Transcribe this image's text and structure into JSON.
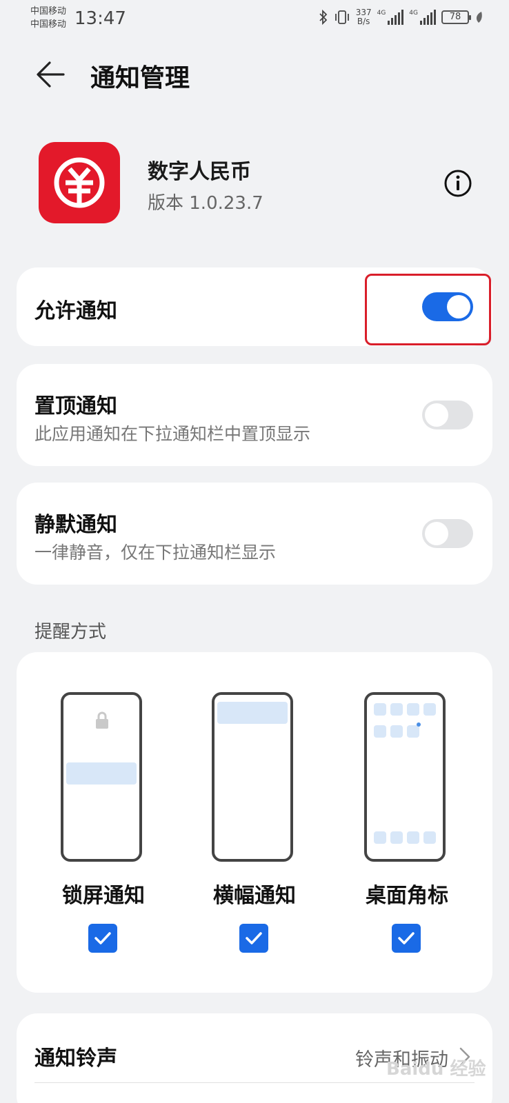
{
  "status_bar": {
    "carrier_1": "中国移动",
    "carrier_2": "中国移动",
    "time": "13:47",
    "speed_value": "337",
    "speed_unit": "B/s",
    "network_1": "4G",
    "network_2": "4G",
    "battery": "78"
  },
  "header": {
    "title": "通知管理"
  },
  "app": {
    "name": "数字人民币",
    "version": "版本 1.0.23.7"
  },
  "allow_notifications": {
    "label": "允许通知",
    "enabled": true
  },
  "pin_notifications": {
    "label": "置顶通知",
    "description": "此应用通知在下拉通知栏中置顶显示",
    "enabled": false
  },
  "silent_notifications": {
    "label": "静默通知",
    "description": "一律静音，仅在下拉通知栏显示",
    "enabled": false
  },
  "alert_styles": {
    "section_title": "提醒方式",
    "options": [
      {
        "label": "锁屏通知",
        "checked": true
      },
      {
        "label": "横幅通知",
        "checked": true
      },
      {
        "label": "桌面角标",
        "checked": true
      }
    ]
  },
  "ringtone": {
    "label": "通知铃声",
    "value": "铃声和振动"
  },
  "watermark": "Baidu 经验",
  "colors": {
    "accent": "#1a6ae6",
    "app_icon": "#e3192a",
    "highlight": "#d91e2a"
  }
}
